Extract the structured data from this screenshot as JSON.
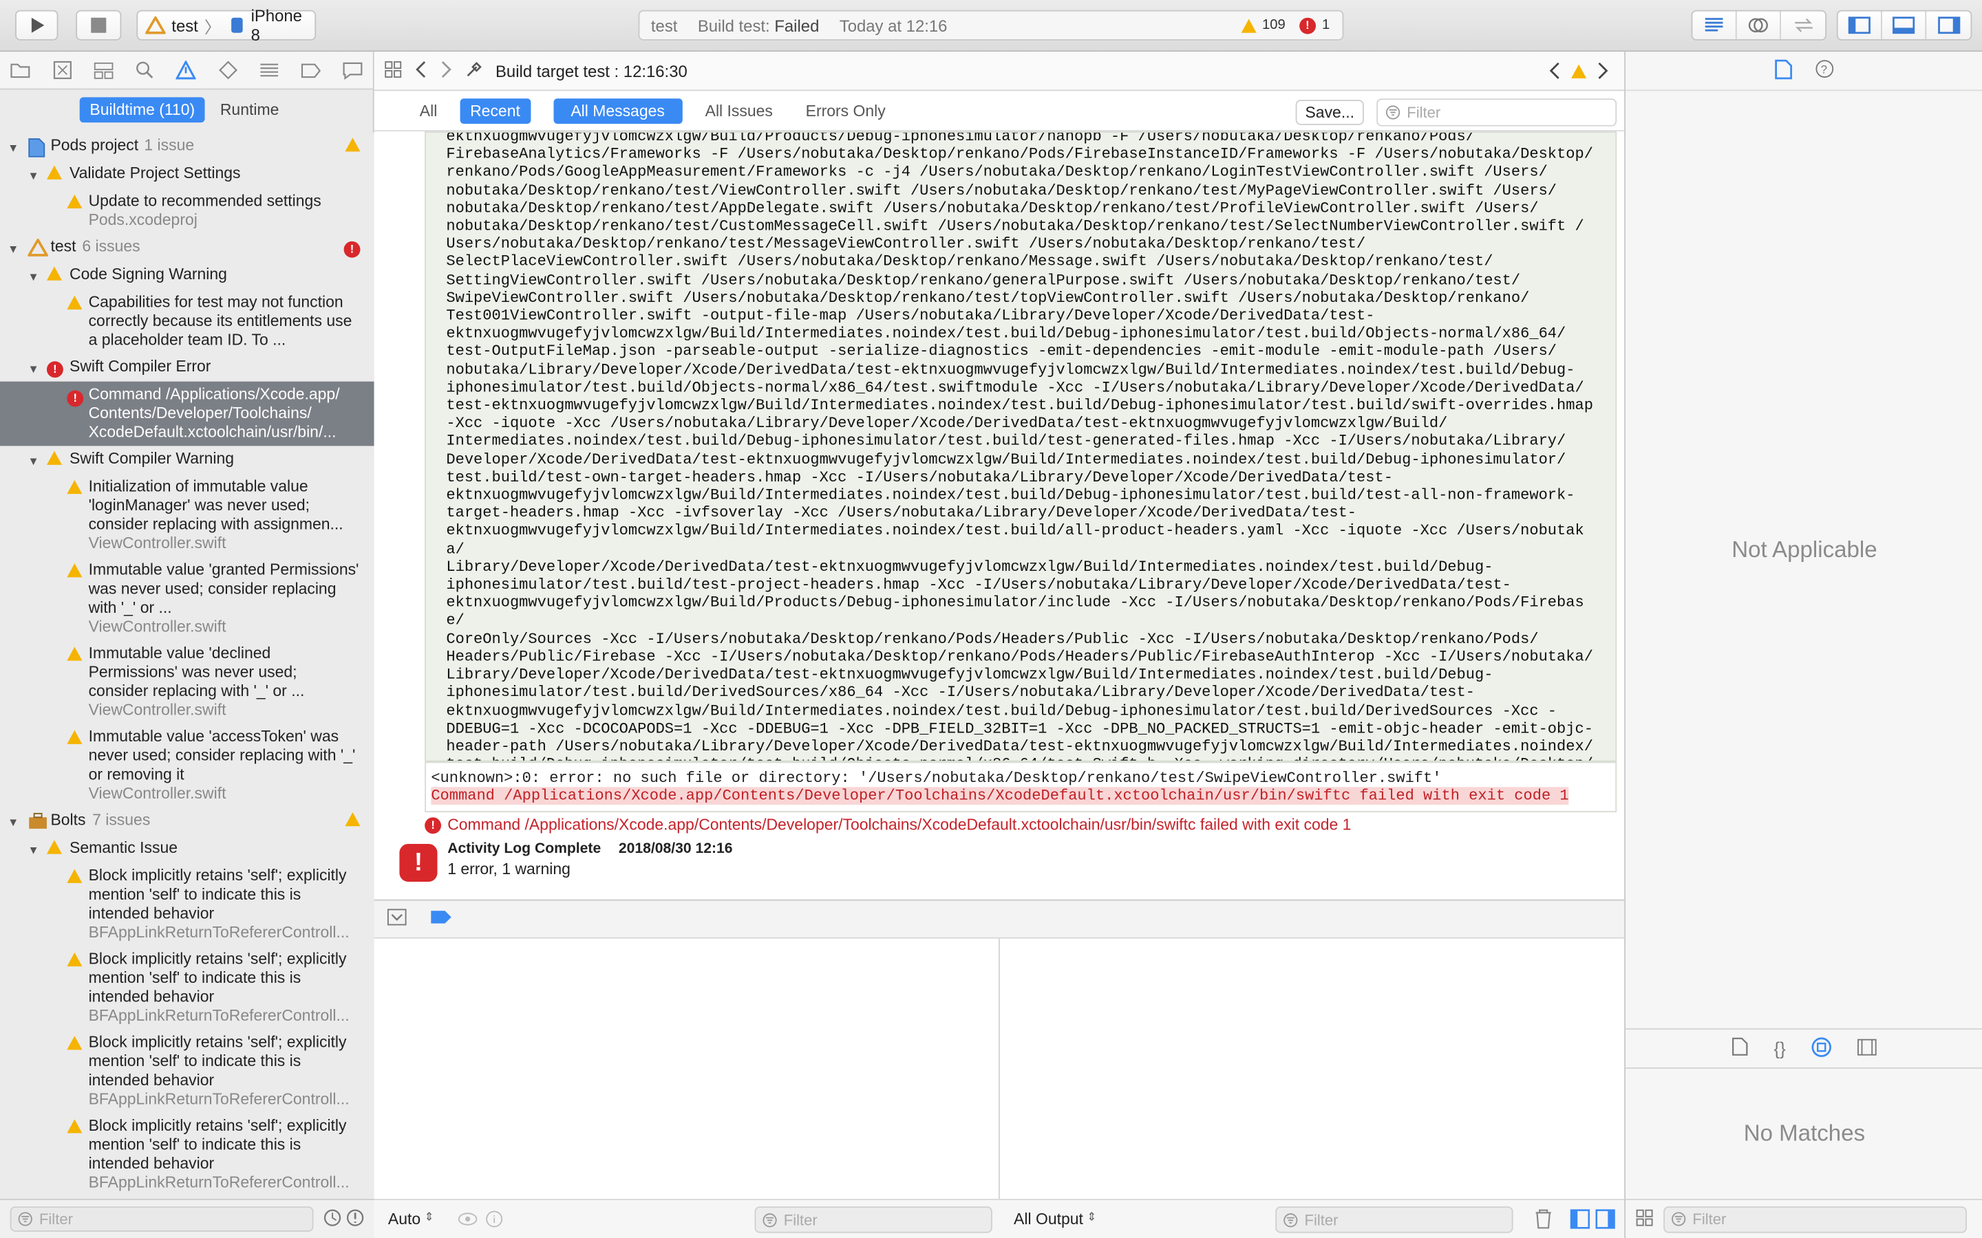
{
  "toolbar": {
    "scheme": "test",
    "device": "iPhone 8",
    "activity": {
      "project": "test",
      "status": "Build test: Failed",
      "time": "Today at 12:16",
      "warnings": "109",
      "errors": "1"
    }
  },
  "navigator": {
    "segments": [
      "Buildtime (110)",
      "Runtime"
    ],
    "filter_placeholder": "Filter",
    "tree": [
      {
        "kind": "project",
        "title": "Pods project",
        "count": "1 issue",
        "icon": "warning"
      },
      {
        "kind": "group",
        "title": "Validate Project Settings",
        "icon": "warning"
      },
      {
        "kind": "issue",
        "icon": "warning",
        "text": "Update to recommended settings",
        "file": "Pods.xcodeproj"
      },
      {
        "kind": "project",
        "title": "test",
        "count": "6 issues",
        "icon": "error"
      },
      {
        "kind": "group",
        "title": "Code Signing Warning",
        "icon": "warning"
      },
      {
        "kind": "issue",
        "icon": "warning",
        "text": "Capabilities for test may not function correctly because its entitlements use a placeholder team ID. To ...",
        "file": ""
      },
      {
        "kind": "group",
        "title": "Swift Compiler Error",
        "icon": "error"
      },
      {
        "kind": "issue",
        "icon": "error",
        "selected": true,
        "text": "Command /Applications/Xcode.app/ Contents/Developer/Toolchains/ XcodeDefault.xctoolchain/usr/bin/...",
        "file": ""
      },
      {
        "kind": "group",
        "title": "Swift Compiler Warning",
        "icon": "warning"
      },
      {
        "kind": "issue",
        "icon": "warning",
        "text": "Initialization of immutable value 'loginManager' was never used; consider replacing with assignmen...",
        "file": "ViewController.swift"
      },
      {
        "kind": "issue",
        "icon": "warning",
        "text": "Immutable value 'granted Permissions' was never used; consider replacing with '_' or ...",
        "file": "ViewController.swift"
      },
      {
        "kind": "issue",
        "icon": "warning",
        "text": "Immutable value 'declined Permissions' was never used; consider replacing with '_' or ...",
        "file": "ViewController.swift"
      },
      {
        "kind": "issue",
        "icon": "warning",
        "text": "Immutable value 'accessToken' was never used; consider replacing with '_' or removing it",
        "file": "ViewController.swift"
      },
      {
        "kind": "project",
        "title": "Bolts",
        "count": "7 issues",
        "icon": "warning"
      },
      {
        "kind": "group",
        "title": "Semantic Issue",
        "icon": "warning"
      },
      {
        "kind": "issue",
        "icon": "warning",
        "text": "Block implicitly retains 'self'; explicitly mention 'self' to indicate this is intended behavior",
        "file": "BFAppLinkReturnToRefererControll..."
      },
      {
        "kind": "issue",
        "icon": "warning",
        "text": "Block implicitly retains 'self'; explicitly mention 'self' to indicate this is intended behavior",
        "file": "BFAppLinkReturnToRefererControll..."
      },
      {
        "kind": "issue",
        "icon": "warning",
        "text": "Block implicitly retains 'self'; explicitly mention 'self' to indicate this is intended behavior",
        "file": "BFAppLinkReturnToRefererControll..."
      },
      {
        "kind": "issue",
        "icon": "warning",
        "text": "Block implicitly retains 'self'; explicitly mention 'self' to indicate this is intended behavior",
        "file": "BFAppLinkReturnToRefererControll..."
      }
    ]
  },
  "editor": {
    "jump_title": "Build target test : 12:16:30",
    "scope": [
      "All",
      "Recent"
    ],
    "messages": [
      "All Messages",
      "All Issues",
      "Errors Only"
    ],
    "save_label": "Save...",
    "filter_placeholder": "Filter",
    "log": "ektnxuogmwvugefyjvlomcwzxlgw/Build/Products/Debug-iphonesimulator/nanopb -F /Users/nobutaka/Desktop/renkano/Pods/\nFirebaseAnalytics/Frameworks -F /Users/nobutaka/Desktop/renkano/Pods/FirebaseInstanceID/Frameworks -F /Users/nobutaka/Desktop/\nrenkano/Pods/GoogleAppMeasurement/Frameworks -c -j4 /Users/nobutaka/Desktop/renkano/LoginTestViewController.swift /Users/\nnobutaka/Desktop/renkano/test/ViewController.swift /Users/nobutaka/Desktop/renkano/test/MyPageViewController.swift /Users/\nnobutaka/Desktop/renkano/test/AppDelegate.swift /Users/nobutaka/Desktop/renkano/test/ProfileViewController.swift /Users/\nnobutaka/Desktop/renkano/test/CustomMessageCell.swift /Users/nobutaka/Desktop/renkano/test/SelectNumberViewController.swift /\nUsers/nobutaka/Desktop/renkano/test/MessageViewController.swift /Users/nobutaka/Desktop/renkano/test/\nSelectPlaceViewController.swift /Users/nobutaka/Desktop/renkano/Message.swift /Users/nobutaka/Desktop/renkano/test/\nSettingViewController.swift /Users/nobutaka/Desktop/renkano/generalPurpose.swift /Users/nobutaka/Desktop/renkano/test/\nSwipeViewController.swift /Users/nobutaka/Desktop/renkano/test/topViewController.swift /Users/nobutaka/Desktop/renkano/\nTest001ViewController.swift -output-file-map /Users/nobutaka/Library/Developer/Xcode/DerivedData/test-\nektnxuogmwvugefyjvlomcwzxlgw/Build/Intermediates.noindex/test.build/Debug-iphonesimulator/test.build/Objects-normal/x86_64/\ntest-OutputFileMap.json -parseable-output -serialize-diagnostics -emit-dependencies -emit-module -emit-module-path /Users/\nnobutaka/Library/Developer/Xcode/DerivedData/test-ektnxuogmwvugefyjvlomcwzxlgw/Build/Intermediates.noindex/test.build/Debug-\niphonesimulator/test.build/Objects-normal/x86_64/test.swiftmodule -Xcc -I/Users/nobutaka/Library/Developer/Xcode/DerivedData/\ntest-ektnxuogmwvugefyjvlomcwzxlgw/Build/Intermediates.noindex/test.build/Debug-iphonesimulator/test.build/swift-overrides.hmap\n-Xcc -iquote -Xcc /Users/nobutaka/Library/Developer/Xcode/DerivedData/test-ektnxuogmwvugefyjvlomcwzxlgw/Build/\nIntermediates.noindex/test.build/Debug-iphonesimulator/test.build/test-generated-files.hmap -Xcc -I/Users/nobutaka/Library/\nDeveloper/Xcode/DerivedData/test-ektnxuogmwvugefyjvlomcwzxlgw/Build/Intermediates.noindex/test.build/Debug-iphonesimulator/\ntest.build/test-own-target-headers.hmap -Xcc -I/Users/nobutaka/Library/Developer/Xcode/DerivedData/test-\nektnxuogmwvugefyjvlomcwzxlgw/Build/Intermediates.noindex/test.build/Debug-iphonesimulator/test.build/test-all-non-framework-\ntarget-headers.hmap -Xcc -ivfsoverlay -Xcc /Users/nobutaka/Library/Developer/Xcode/DerivedData/test-\nektnxuogmwvugefyjvlomcwzxlgw/Build/Intermediates.noindex/test.build/all-product-headers.yaml -Xcc -iquote -Xcc /Users/nobutaka/\nLibrary/Developer/Xcode/DerivedData/test-ektnxuogmwvugefyjvlomcwzxlgw/Build/Intermediates.noindex/test.build/Debug-\niphonesimulator/test.build/test-project-headers.hmap -Xcc -I/Users/nobutaka/Library/Developer/Xcode/DerivedData/test-\nektnxuogmwvugefyjvlomcwzxlgw/Build/Products/Debug-iphonesimulator/include -Xcc -I/Users/nobutaka/Desktop/renkano/Pods/Firebase/\nCoreOnly/Sources -Xcc -I/Users/nobutaka/Desktop/renkano/Pods/Headers/Public -Xcc -I/Users/nobutaka/Desktop/renkano/Pods/\nHeaders/Public/Firebase -Xcc -I/Users/nobutaka/Desktop/renkano/Pods/Headers/Public/FirebaseAuthInterop -Xcc -I/Users/nobutaka/\nLibrary/Developer/Xcode/DerivedData/test-ektnxuogmwvugefyjvlomcwzxlgw/Build/Intermediates.noindex/test.build/Debug-\niphonesimulator/test.build/DerivedSources/x86_64 -Xcc -I/Users/nobutaka/Library/Developer/Xcode/DerivedData/test-\nektnxuogmwvugefyjvlomcwzxlgw/Build/Intermediates.noindex/test.build/Debug-iphonesimulator/test.build/DerivedSources -Xcc -\nDDEBUG=1 -Xcc -DCOCOAPODS=1 -Xcc -DDEBUG=1 -Xcc -DPB_FIELD_32BIT=1 -Xcc -DPB_NO_PACKED_STRUCTS=1 -emit-objc-header -emit-objc-\nheader-path /Users/nobutaka/Library/Developer/Xcode/DerivedData/test-ektnxuogmwvugefyjvlomcwzxlgw/Build/Intermediates.noindex/\ntest.build/Debug-iphonesimulator/test.build/Objects-normal/x86_64/test-Swift.h -Xcc -working-directory/Users/nobutaka/Desktop/\nrenkano",
    "error_line1": "<unknown>:0: error: no such file or directory: '/Users/nobutaka/Desktop/renkano/test/SwipeViewController.swift'",
    "error_line2": "Command /Applications/Xcode.app/Contents/Developer/Toolchains/XcodeDefault.xctoolchain/usr/bin/swiftc failed with exit code 1",
    "command_failed": "Command /Applications/Xcode.app/Contents/Developer/Toolchains/XcodeDefault.xctoolchain/usr/bin/swiftc failed with exit code 1",
    "complete_title": "Activity Log Complete",
    "complete_date": "2018/08/30 12:16",
    "complete_summary": "1 error, 1 warning"
  },
  "debug": {
    "auto_label": "Auto",
    "output_label": "All Output",
    "filter_placeholder": "Filter"
  },
  "inspector": {
    "not_applicable": "Not Applicable",
    "no_matches": "No Matches",
    "filter_placeholder": "Filter"
  },
  "colors": {
    "accent": "#3a8af4",
    "error": "#d8282c",
    "warning": "#f5b400",
    "selection": "#7b7f86"
  }
}
